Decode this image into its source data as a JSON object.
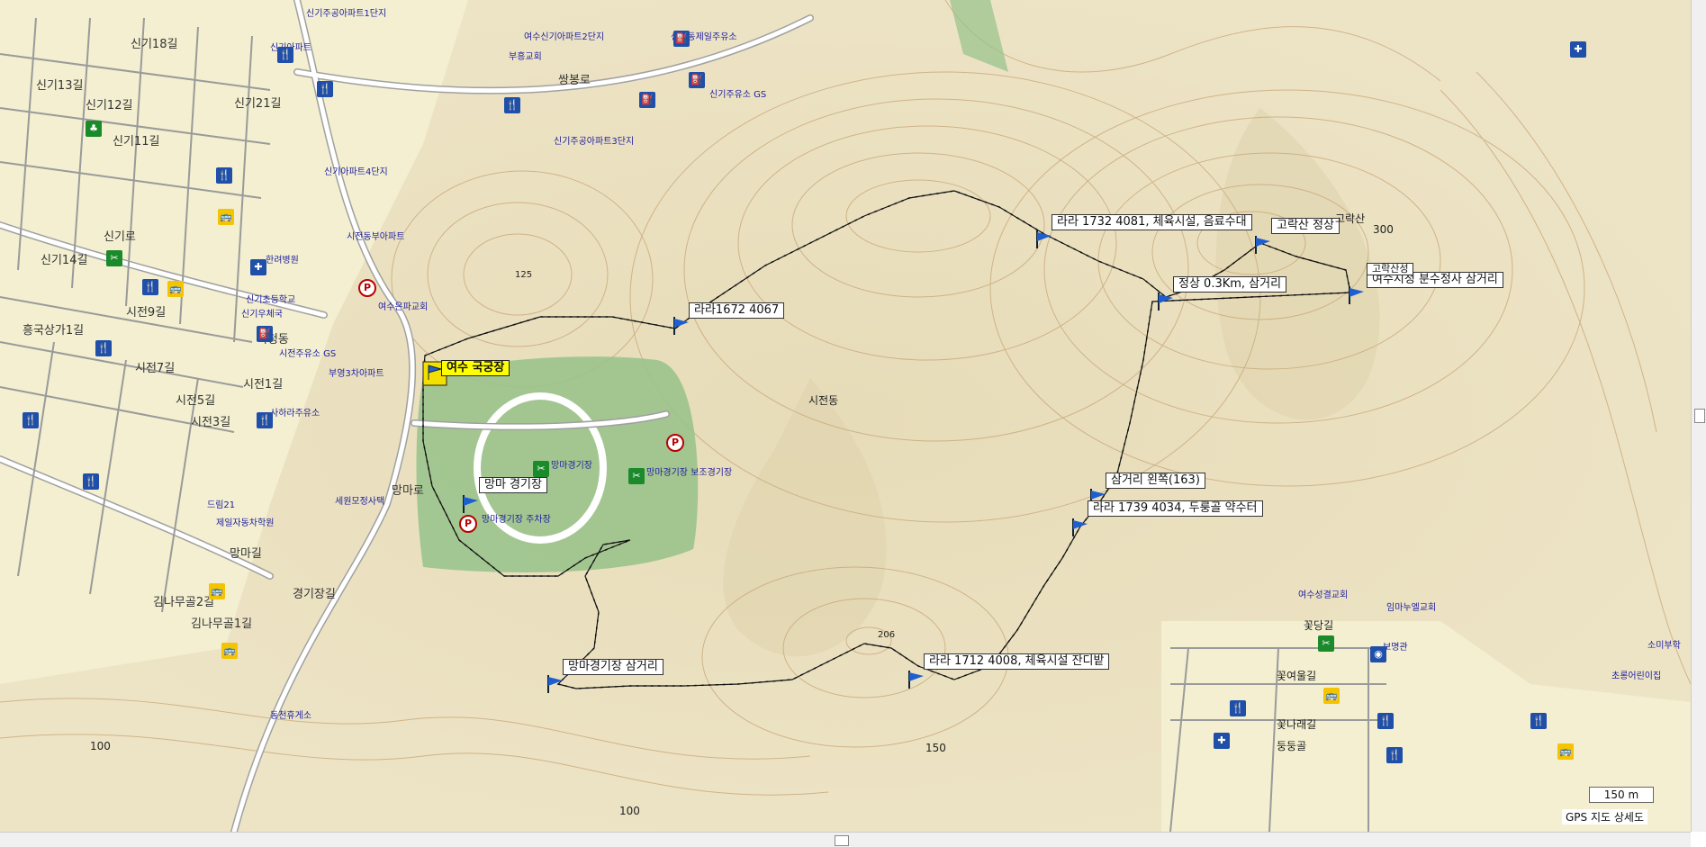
{
  "colors": {
    "terrain": "#ece3c4",
    "contour": "#c9a87a",
    "park": "#97c28a",
    "road": "#ffffff",
    "track": "#111111",
    "poi_blue": "#1f4fa8",
    "flag_blue": "#1e5fd0",
    "highlight": "#ffff00"
  },
  "waypoints": [
    {
      "label": "여수 국궁장",
      "highlight": true
    },
    {
      "label": "라라1672 4067"
    },
    {
      "label": "라라 1732 4081, 체육시설, 음료수대"
    },
    {
      "label": "고락산 정상"
    },
    {
      "label": "정상 0.3Km, 삼거리"
    },
    {
      "label": "여수시청 분수정사 삼거리"
    },
    {
      "label": "망마 경기장"
    },
    {
      "label": "삼거리 왼쪽(163)"
    },
    {
      "label": "라라 1739 4034, 두룽골 약수터"
    },
    {
      "label": "라라 1712 4008, 체육시설 잔디밭"
    },
    {
      "label": "망마경기장 삼거리"
    }
  ],
  "streets": [
    "신기18길",
    "신기12길",
    "신기11길",
    "신기로",
    "시전9길",
    "시전7길",
    "시전5길",
    "시전3길",
    "시전1길",
    "흥국상가1길",
    "신기14길",
    "신기13길",
    "신기21길",
    "쌍봉로",
    "망마로",
    "망마길",
    "경기장길",
    "김나무골2길",
    "김나무골1길",
    "시청동"
  ],
  "places": [
    "신기주공아파트1단지",
    "신기아파트",
    "여수신기아파트2단지",
    "신기주유소 GS",
    "부흥교회",
    "신기주공아파트3단지",
    "신기아파트4단지",
    "신기동제일주유소",
    "한려병원",
    "신기초등학교",
    "신기우체국",
    "여수은파교회",
    "시전주유소 GS",
    "부영3차아파트",
    "시전동부아파트",
    "사하라주유소",
    "제일자동차학원",
    "드림21",
    "세원모정사택",
    "망마경기장",
    "망마경기장 보조경기장",
    "망마경기장 주차장",
    "시전동",
    "고락산",
    "여수성결교회",
    "임마누엘교회",
    "꽃당길",
    "꽃여울길",
    "꽃나래길",
    "둥둥골",
    "동천휴게소",
    "보명관",
    "소미부학",
    "초롱어린이집"
  ],
  "elevations": [
    "125",
    "206",
    "300",
    "150",
    "100",
    "100"
  ],
  "contour_labels": [
    "고락산성"
  ],
  "scale": {
    "label": "150 m"
  },
  "map_name": "GPS 지도 상세도"
}
